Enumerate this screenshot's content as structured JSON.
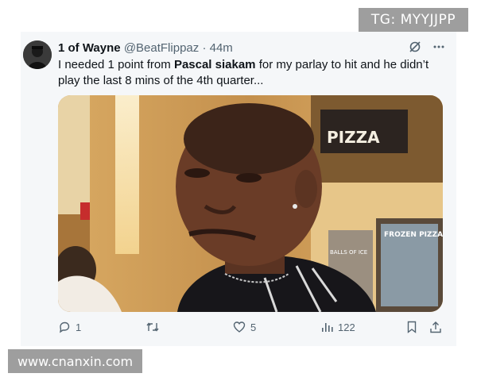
{
  "watermarks": {
    "top": "TG: MYYJJPP",
    "bottom": "www.cnanxin.com"
  },
  "tweet": {
    "display_name": "1 of Wayne",
    "handle": "@BeatFlippaz",
    "separator": "·",
    "time": "44m",
    "text_before": "I needed 1 point from ",
    "text_bold": "Pascal siakam",
    "text_after": " for my parlay to hit and he didn’t play the last 8 mins of the 4th quarter...",
    "media": {
      "store_sign": "PIZZA",
      "freezer_label": "FROZEN PIZZA",
      "freezer_label_2": "BALLS OF ICE"
    }
  },
  "actions": {
    "replies": "1",
    "retweets": "",
    "likes": "5",
    "views": "122"
  },
  "icons": {
    "top_right": [
      "grok-icon",
      "more-icon"
    ],
    "action_bar": [
      "reply-icon",
      "retweet-icon",
      "like-icon",
      "views-icon",
      "bookmark-icon",
      "share-icon"
    ]
  },
  "colors": {
    "card_bg": "#f5f7f9",
    "text": "#0f1419",
    "secondary": "#536471",
    "watermark_bg": "#9e9e9e"
  }
}
